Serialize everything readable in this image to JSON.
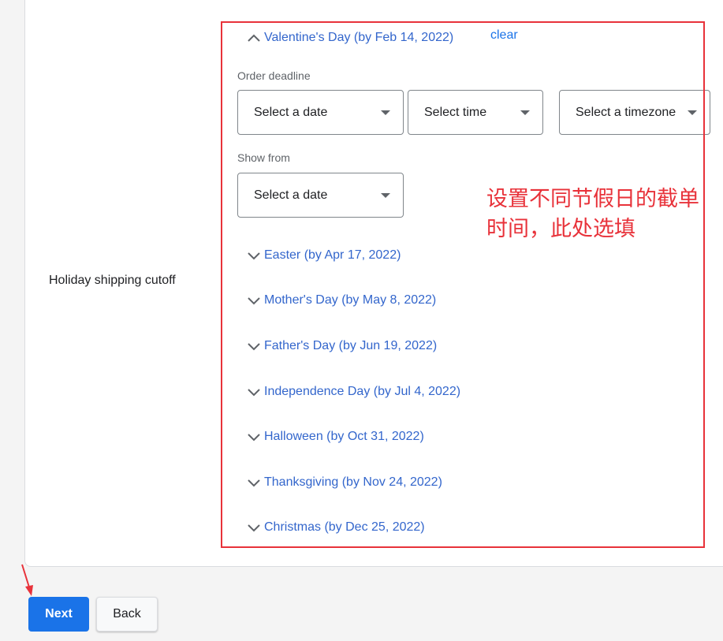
{
  "row_label": "Holiday shipping cutoff",
  "expanded": {
    "title": "Valentine's Day (by Feb 14, 2022)",
    "clear_label": "clear",
    "order_deadline_label": "Order deadline",
    "date_select": "Select a date",
    "time_select": "Select time",
    "timezone_select": "Select a timezone",
    "show_from_label": "Show from",
    "show_from_select": "Select a date"
  },
  "holidays": [
    "Easter (by Apr 17, 2022)",
    "Mother's Day (by May 8, 2022)",
    "Father's Day (by Jun 19, 2022)",
    "Independence Day (by Jul 4, 2022)",
    "Halloween (by Oct 31, 2022)",
    "Thanksgiving (by Nov 24, 2022)",
    "Christmas (by Dec 25, 2022)"
  ],
  "annotation": {
    "line1": "设置不同节假日的截单",
    "line2": "时间，此处选填"
  },
  "buttons": {
    "next": "Next",
    "back": "Back"
  },
  "colors": {
    "link": "#3366cc",
    "primary": "#1a73e8",
    "annotation": "#e8323a"
  },
  "icons": {
    "expanded": "chevron-up-icon",
    "collapsed": "chevron-down-icon"
  }
}
